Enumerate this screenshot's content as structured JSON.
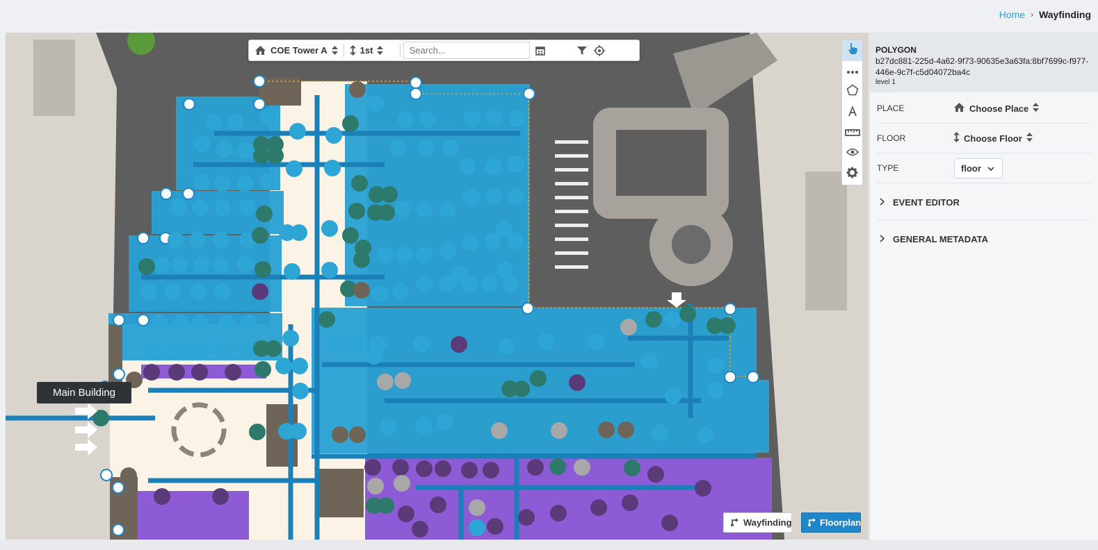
{
  "breadcrumb": {
    "home": "Home",
    "separator": "›",
    "current": "Wayfinding"
  },
  "toolbar": {
    "place": "COE Tower A",
    "floor": "1st",
    "search_placeholder": "Search...",
    "icons": [
      "home-icon",
      "sort-icon",
      "up-down-arrows-icon",
      "calendar-icon",
      "filter-icon",
      "locate-icon"
    ]
  },
  "map": {
    "building_label": "Main Building"
  },
  "tools": [
    "pointer-icon",
    "dots-icon",
    "pentagon-icon",
    "text-icon",
    "ruler-icon",
    "eye-icon",
    "gear-icon"
  ],
  "buttons": {
    "wayfinding": "Wayfinding",
    "floorplan": "Floorplan"
  },
  "panel": {
    "type_title": "POLYGON",
    "id": "b27dc881-225d-4a62-9f73-90635e3a63fa:8bf7699c-f977-446e-9c7f-c5d04072ba4c",
    "level": "level 1",
    "place_label": "PLACE",
    "place_value": "Choose Place",
    "floor_label": "FLOOR",
    "floor_value": "Choose Floor",
    "type_label": "TYPE",
    "type_value": "floor",
    "sections": [
      "EVENT EDITOR",
      "GENERAL METADATA"
    ]
  },
  "colors": {
    "accent": "#2aa3d8",
    "floor_blue": "#29a1d4",
    "purple": "#8e5bd6",
    "teal": "#2d7a6c"
  }
}
